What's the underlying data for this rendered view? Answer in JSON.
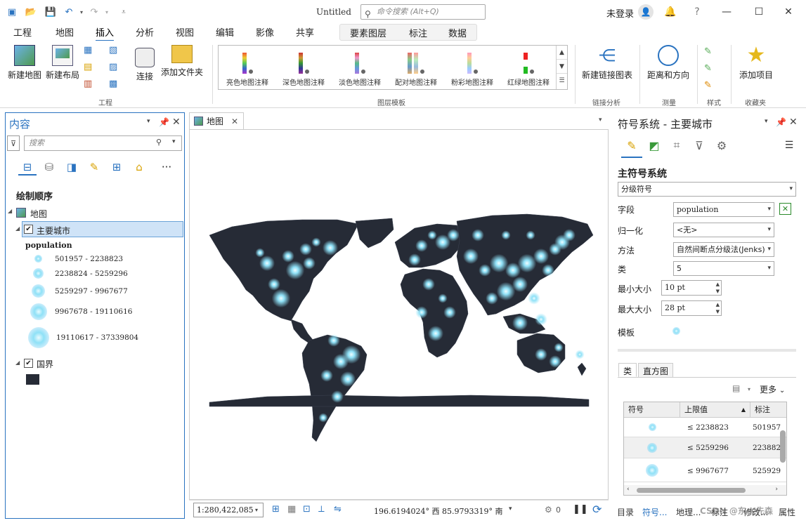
{
  "titlebar": {
    "title": "Untitled",
    "command_search_placeholder": "命令搜索 (Alt+Q)",
    "signin": "未登录",
    "help": "?"
  },
  "ribbon_tabs": [
    "工程",
    "地图",
    "插入",
    "分析",
    "视图",
    "编辑",
    "影像",
    "共享"
  ],
  "active_tab": "插入",
  "contextual_tabs": [
    "要素图层",
    "标注",
    "数据"
  ],
  "ribbon": {
    "project_group": {
      "label": "工程",
      "new_map": "新建地图",
      "new_layout": "新建布局",
      "connect": "连接",
      "add_folder": "添加文件夹"
    },
    "layer_templates": {
      "label": "图层模板",
      "items": [
        "亮色地图注释",
        "深色地图注释",
        "淡色地图注释",
        "配对地图注释",
        "粉彩地图注释",
        "红绿地图注释"
      ]
    },
    "link_analysis": {
      "label": "链接分析",
      "new_link_chart": "新建链接图表"
    },
    "measure": {
      "label": "测量",
      "distance_direction": "距离和方向"
    },
    "styles": {
      "label": "样式"
    },
    "favorites": {
      "label": "收藏夹",
      "add_item": "添加项目"
    }
  },
  "contents_pane": {
    "title": "内容",
    "search_placeholder": "搜索",
    "drawing_order": "绘制顺序",
    "map_name": "地图",
    "layer_cities": "主要城市",
    "field": "population",
    "legend": [
      "501957 - 2238823",
      "2238824 - 5259296",
      "5259297 - 9967677",
      "9967678 - 19110616",
      "19110617 - 37339804"
    ],
    "layer_boundaries": "国界",
    "more": "···"
  },
  "map_view": {
    "tab_label": "地图",
    "scale": "1:280,422,085",
    "coordinates": "196.6194024° 西 85.9793319° 南",
    "events_count": "0",
    "land_color": "#262b36",
    "glow_color": "#8fe1f7"
  },
  "symbology_pane": {
    "title": "符号系统 - 主要城市",
    "primary_symbology": "主符号系统",
    "method_type": "分级符号",
    "field_label": "字段",
    "field_value": "population",
    "normalization_label": "归一化",
    "normalization_value": "<无>",
    "method_label": "方法",
    "method_value": "自然间断点分级法(Jenks)",
    "classes_label": "类",
    "classes_value": "5",
    "min_size_label": "最小大小",
    "min_size_value": "10 pt",
    "max_size_label": "最大大小",
    "max_size_value": "28 pt",
    "template_label": "模板",
    "subtabs": [
      "类",
      "直方图"
    ],
    "more": "更多",
    "table_headers": [
      "符号",
      "上限值",
      "标注"
    ],
    "table_rows": [
      {
        "upper": "≤   2238823",
        "label": "501957"
      },
      {
        "upper": "≤   5259296",
        "label": "223882"
      },
      {
        "upper": "≤   9967677",
        "label": "525929"
      }
    ]
  },
  "bottom_tabs": [
    "目录",
    "符号...",
    "地理...",
    "标注",
    "修改...",
    "属性"
  ],
  "watermark": "CSDN @东·K先森"
}
